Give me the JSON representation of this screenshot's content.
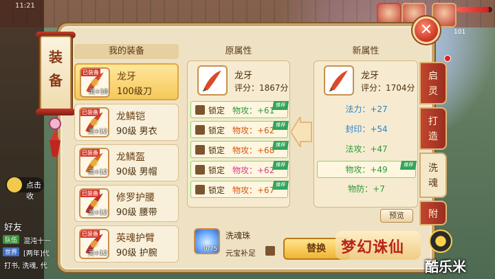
{
  "status_bar": {
    "time": "11:21"
  },
  "hud": {
    "right_level": "101"
  },
  "banner": {
    "title": "装备"
  },
  "left_ui": {
    "recording_hint": "点击收",
    "chat_tag1": "队伍",
    "chat_text1": "混沌十一",
    "chat_tag2": "世界",
    "chat_text2": "[两年]代",
    "chat_text3": "打书, 洗魂, 代",
    "friend": "好友"
  },
  "my_equipment": {
    "header": "我的装备",
    "items": [
      {
        "tag": "已装备",
        "ling": "灵+18",
        "name": "龙牙",
        "sub": "100级刀",
        "color": "#d94b2b"
      },
      {
        "tag": "已装备",
        "ling": "灵+12",
        "name": "龙鳞铠",
        "sub": "90级 男衣",
        "color": "#c9451e"
      },
      {
        "tag": "已装备",
        "ling": "灵+12",
        "name": "龙鳞盔",
        "sub": "90级 男帽",
        "color": "#d1701e"
      },
      {
        "tag": "已装备",
        "ling": "灵+12",
        "name": "修罗护腰",
        "sub": "90级 腰带",
        "color": "#b8321f"
      },
      {
        "tag": "已装备",
        "ling": "灵+12",
        "name": "英魂护臂",
        "sub": "90级 护腕",
        "color": "#c03530"
      }
    ]
  },
  "original": {
    "title": "原属性",
    "item_name": "龙牙",
    "score": "评分：1867分",
    "lock_label": "锁定",
    "attrs": [
      {
        "text": "物攻：+61",
        "color": "#2a9a3a",
        "rec": "推荐"
      },
      {
        "text": "物攻：+62",
        "color": "#d4560f",
        "rec": "推荐"
      },
      {
        "text": "物攻：+68",
        "color": "#d4560f",
        "rec": "推荐"
      },
      {
        "text": "物攻：+62",
        "color": "#d73b8a",
        "rec": "推荐"
      },
      {
        "text": "物攻：+67",
        "color": "#d4560f",
        "rec": "推荐"
      }
    ]
  },
  "new": {
    "title": "新属性",
    "item_name": "龙牙",
    "score": "评分：1704分",
    "attrs": [
      {
        "text": "法力：+27",
        "color": "#2a7fc9"
      },
      {
        "text": "封印：+54",
        "color": "#2a7fc9"
      },
      {
        "text": "法攻：+47",
        "color": "#2a9a3a"
      },
      {
        "text": "物攻：+49",
        "color": "#2a9a3a",
        "rec": "推荐"
      },
      {
        "text": "物防：+7",
        "color": "#2a9a3a"
      }
    ],
    "preview": "预览"
  },
  "soul_pearl": {
    "name": "洗魂珠",
    "count": "9/75",
    "yuanbao": "元宝补足"
  },
  "actions": {
    "swap": "替换"
  },
  "logo": {
    "text": "梦幻诛仙"
  },
  "tabs": [
    "启灵",
    "打造",
    "洗魂",
    "附"
  ],
  "watermark": "酷乐米"
}
